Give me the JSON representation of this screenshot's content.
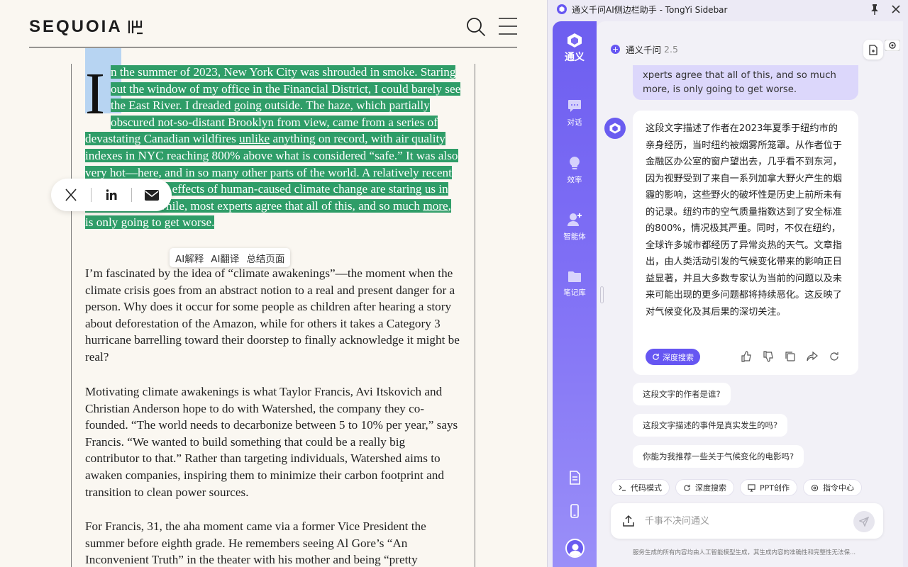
{
  "article": {
    "logo_text": "SEQUOIA",
    "dropcap": "I",
    "p1_segments": [
      "n the summer of 2023, New York City was shrouded in smoke. Staring out the window of my office in the Financial District, I could barely see the East River. I dreaded going outside. The haze, which partially obscured not-so-distant Brooklyn from view, came from a series of devastating Canadian wildfires ",
      "unlike",
      " anything on record, with air quality indexes in NYC reaching 800% above what is considered “safe.” It was also very hot—here, and in so many other parts of the world. A relatively recent phenomenon, the effects of human-caused climate change are staring us in the face. Meanwhile, most experts agree that all of this, and so much ",
      "more",
      ", is only going to get worse."
    ],
    "p2": "I’m fascinated by the idea of “climate awakenings”—the moment when the climate crisis goes from an abstract notion to a real and present danger for a person. Why does it occur for some people as children after hearing a story about deforestation of the Amazon, while for others it takes a Category 3 hurricane barrelling toward their doorstep to finally acknowledge it might be real?",
    "p3": "Motivating climate awakenings is what Taylor Francis, Avi Itskovich and Christian Anderson hope to do with Watershed, the company they co-founded. “The world needs to decarbonize between 5 to 10% per year,” says Francis. “We wanted to build something that could be a really big contributor to that.” Rather than targeting individuals, Watershed aims to awaken companies, inspiring them to minimize their carbon footprint and transition to clean power sources.",
    "p4": "For Francis, 31, the aha moment came via a former Vice President the summer before eighth grade. He remembers seeing Al Gore’s “An Inconvenient Truth” in the theater with his mother and being “pretty"
  },
  "ai_popup": {
    "explain": "AI解释",
    "translate": "AI翻译",
    "summarize": "总结页面"
  },
  "sidebar": {
    "window_title": "通义千问AI侧边栏助手 - TongYi Sidebar",
    "brand": "通义",
    "rail": [
      {
        "label": "对话",
        "icon": "chat-icon"
      },
      {
        "label": "效率",
        "icon": "lightbulb-icon"
      },
      {
        "label": "智能体",
        "icon": "agent-icon"
      },
      {
        "label": "笔记库",
        "icon": "folder-icon"
      }
    ],
    "model_name": "通义千问",
    "model_version": "2.5",
    "user_message": "xperts agree that all of this, and so much more, is only going to get worse.",
    "answer": "这段文字描述了作者在2023年夏季于纽约市的亲身经历，当时纽约被烟雾所笼罩。从作者位于金融区办公室的窗户望出去，几乎看不到东河，因为视野受到了来自一系列加拿大野火产生的烟霾的影响，这些野火的破坏性是历史上前所未有的记录。纽约市的空气质量指数达到了安全标准的800%，情况极其严重。同时，不仅在纽约，全球许多城市都经历了异常炎热的天气。文章指出，由人类活动引发的气候变化带来的影响正日益显著，并且大多数专家认为当前的问题以及未来可能出现的更多问题都将持续恶化。这反映了对气候变化及其后果的深切关注。",
    "deep_search": "深度搜索",
    "suggestions": [
      "这段文字的作者是谁?",
      "这段文字描述的事件是真实发生的吗?",
      "你能为我推荐一些关于气候变化的电影吗?"
    ],
    "modes": [
      {
        "label": "代码模式",
        "icon": "terminal-icon"
      },
      {
        "label": "深度搜索",
        "icon": "refresh-search-icon"
      },
      {
        "label": "PPT创作",
        "icon": "presentation-icon"
      },
      {
        "label": "指令中心",
        "icon": "command-icon"
      }
    ],
    "input_placeholder": "千事不决问通义",
    "disclaimer": "服务生成的所有内容均由人工智能模型生成，其生成内容的准确性和完整性无法保..."
  },
  "colors": {
    "highlight": "#2f9d68",
    "accent": "#6656f2"
  }
}
